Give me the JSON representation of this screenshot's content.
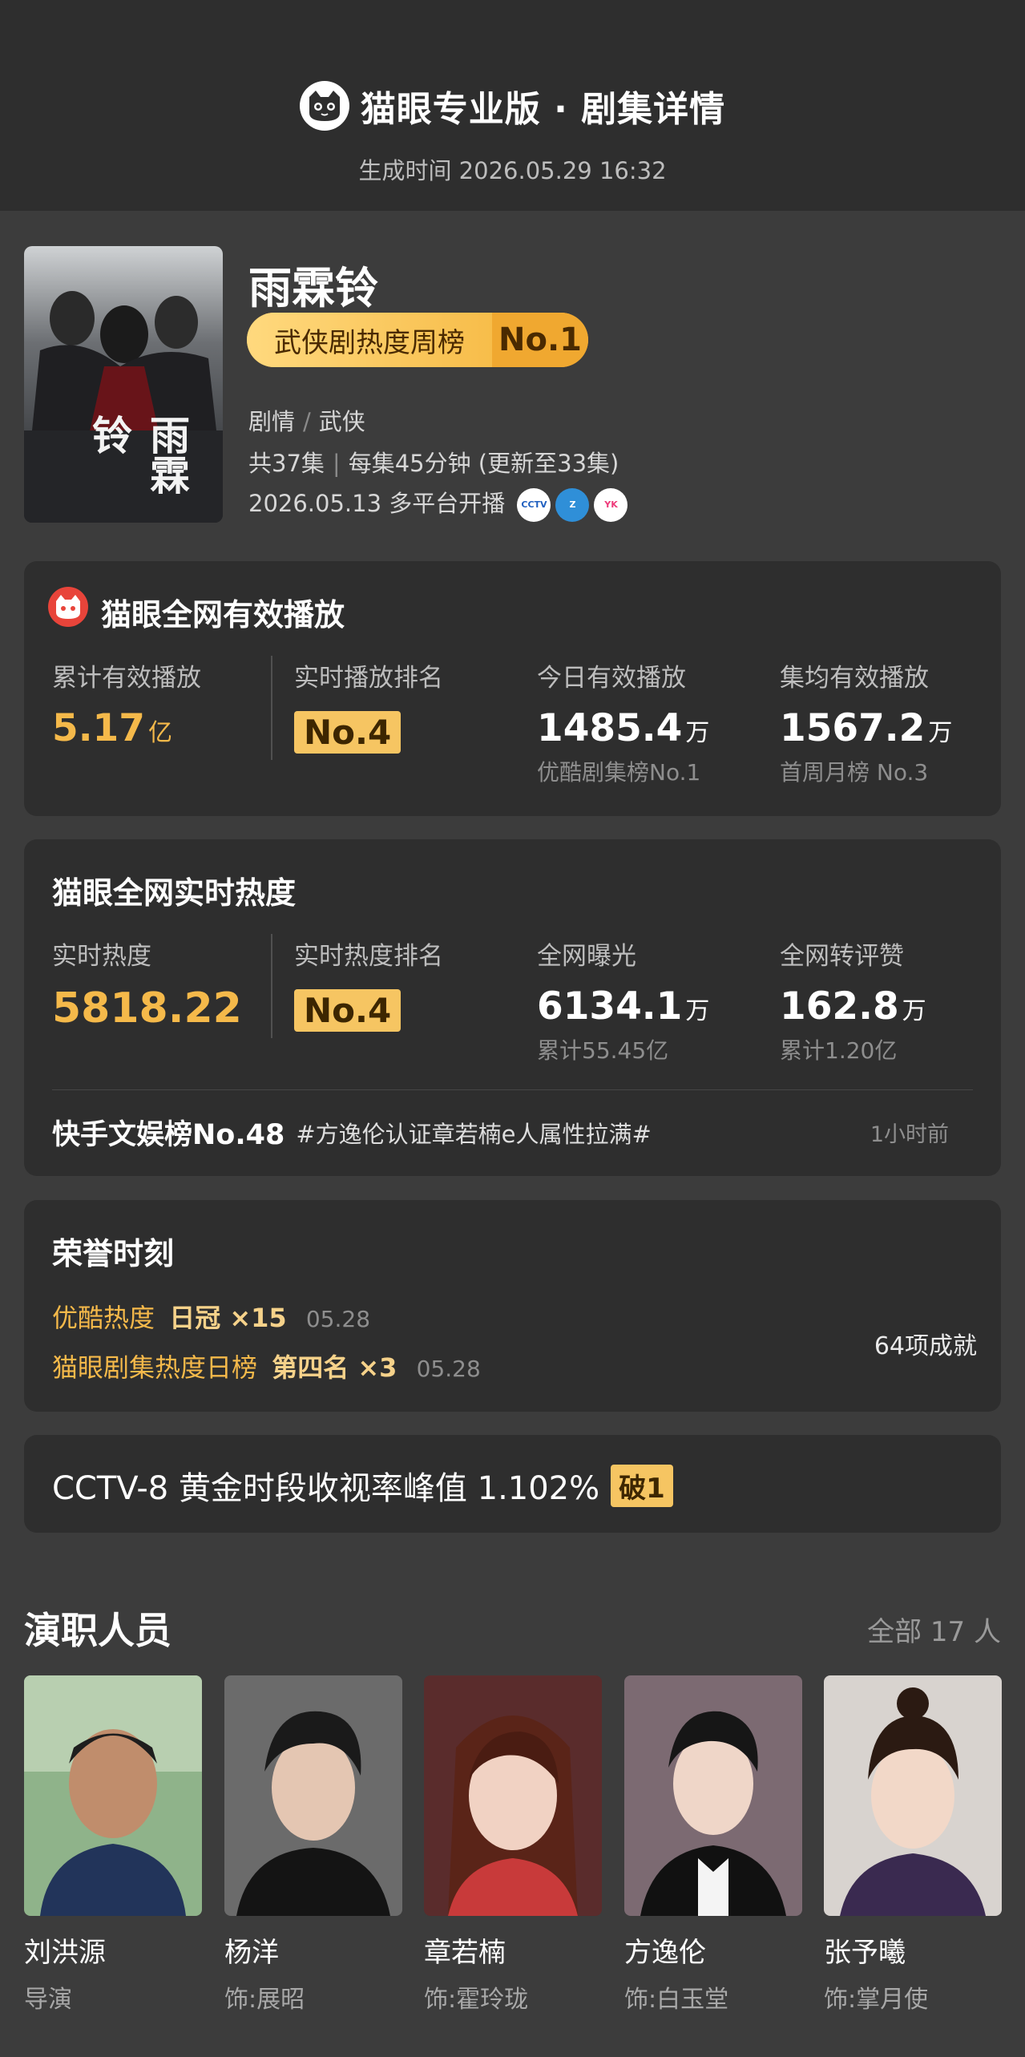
{
  "header": {
    "title": "猫眼专业版 · 剧集详情",
    "generated_time": "生成时间 2026.05.29 16:32"
  },
  "drama": {
    "title": "雨霖铃",
    "rank_label": "武侠剧热度周榜",
    "rank_value": "No.1",
    "genres": [
      "剧情",
      "武侠"
    ],
    "episodes": "共37集",
    "episode_length": "每集45分钟 (更新至33集)",
    "premiere": "2026.05.13 多平台开播",
    "poster_text": "雨霖铃",
    "platforms": [
      "cctv-icon",
      "zhejiang-tv-icon",
      "youku-icon"
    ]
  },
  "plays": {
    "title": "猫眼全网有效播放",
    "stats": [
      {
        "label": "累计有效播放",
        "value": "5.17",
        "unit": "亿",
        "sub": ""
      },
      {
        "label": "实时播放排名",
        "value": "No.4",
        "unit": "",
        "sub": ""
      },
      {
        "label": "今日有效播放",
        "value": "1485.4",
        "unit": "万",
        "sub": "优酷剧集榜No.1"
      },
      {
        "label": "集均有效播放",
        "value": "1567.2",
        "unit": "万",
        "sub": "首周月榜 No.3"
      }
    ]
  },
  "heat": {
    "title": "猫眼全网实时热度",
    "stats": [
      {
        "label": "实时热度",
        "value": "5818.22",
        "unit": "",
        "sub": ""
      },
      {
        "label": "实时热度排名",
        "value": "No.4",
        "unit": "",
        "sub": ""
      },
      {
        "label": "全网曝光",
        "value": "6134.1",
        "unit": "万",
        "sub": "累计55.45亿"
      },
      {
        "label": "全网转评赞",
        "value": "162.8",
        "unit": "万",
        "sub": "累计1.20亿"
      }
    ],
    "trend_rank": "快手文娱榜No.48",
    "trend_topic": "#方逸伦认证章若楠e人属性拉满#",
    "trend_time": "1小时前"
  },
  "honors": {
    "title": "荣誉时刻",
    "items": [
      {
        "platform": "优酷热度",
        "achievement": "日冠 ×15",
        "date": "05.28"
      },
      {
        "platform": "猫眼剧集热度日榜",
        "achievement": "第四名 ×3",
        "date": "05.28"
      }
    ],
    "count": "64项成就"
  },
  "ratings": {
    "text": "CCTV-8 黄金时段收视率峰值 1.102%",
    "badge": "破1"
  },
  "cast": {
    "title": "演职人员",
    "all": "全部 17 人",
    "members": [
      {
        "name": "刘洪源",
        "role": "导演"
      },
      {
        "name": "杨洋",
        "role": "饰:展昭"
      },
      {
        "name": "章若楠",
        "role": "饰:霍玲珑"
      },
      {
        "name": "方逸伦",
        "role": "饰:白玉堂"
      },
      {
        "name": "张予曦",
        "role": "饰:掌月使"
      }
    ]
  }
}
